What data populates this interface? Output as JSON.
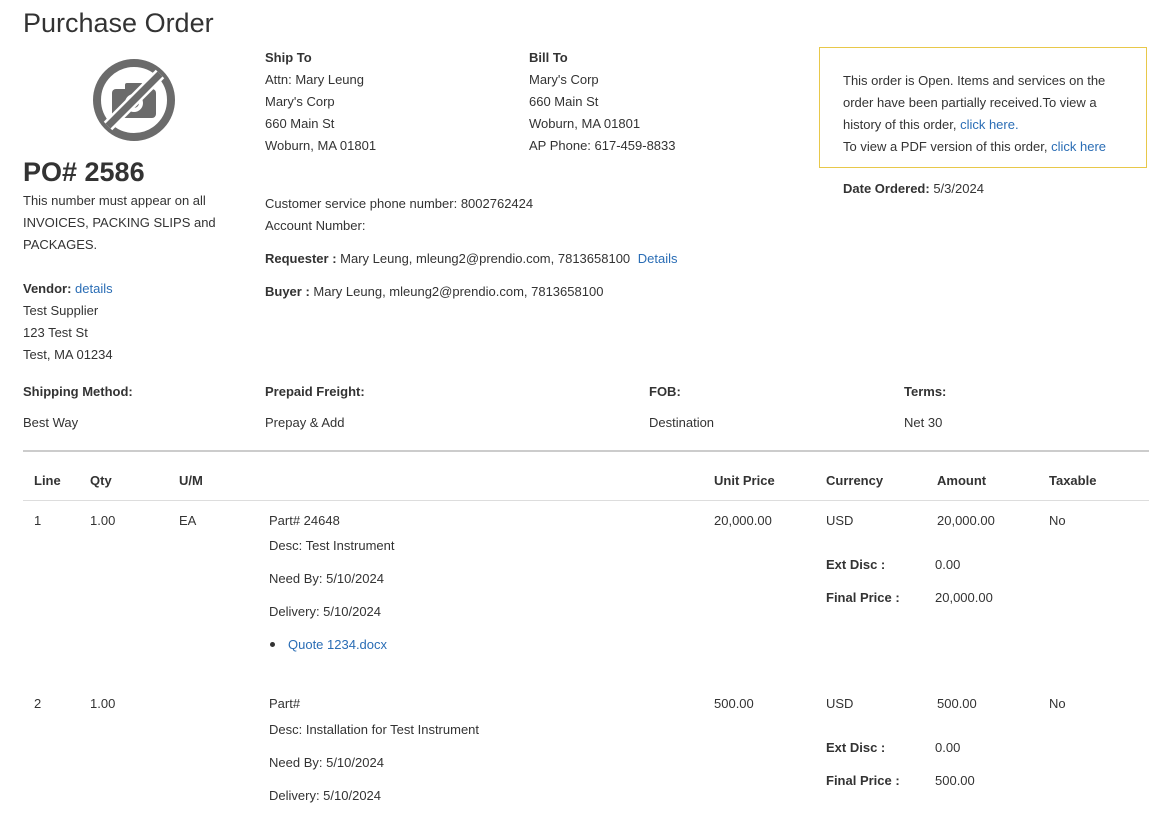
{
  "page": {
    "title": "Purchase Order"
  },
  "logo": {
    "icon": "no-camera-icon"
  },
  "po": {
    "number": "PO# 2586",
    "notice": [
      "This number must appear on all",
      "INVOICES, PACKING SLIPS and",
      "PACKAGES."
    ]
  },
  "vendor": {
    "label": "Vendor:",
    "details_link": "details",
    "name": "Test Supplier",
    "address1": "123 Test St",
    "address2": "Test, MA 01234"
  },
  "ship_to": {
    "label": "Ship To",
    "attn": "Attn: Mary Leung",
    "company": "Mary's Corp",
    "street": "660 Main St",
    "city": "Woburn, MA 01801"
  },
  "bill_to": {
    "label": "Bill To",
    "company": "Mary's Corp",
    "street": "660 Main St",
    "city": "Woburn, MA 01801",
    "phone": "AP Phone: 617-459-8833"
  },
  "status": {
    "text": "This order is Open. Items and services on the order have been partially received.To view a history of this order, ",
    "history_link": "click here.",
    "pdf_text": "To view a PDF version of this order, ",
    "pdf_link": "click here"
  },
  "date_ordered": {
    "label": "Date Ordered:",
    "value": "5/3/2024"
  },
  "contact": {
    "customer_service": "Customer service phone number: 8002762424",
    "account_number": "Account Number:",
    "requester_label": "Requester :",
    "requester_value": "Mary Leung, mleung2@prendio.com, 7813658100",
    "requester_details": "Details",
    "buyer_label": "Buyer :",
    "buyer_value": "Mary Leung, mleung2@prendio.com, 7813658100"
  },
  "shipping": {
    "method_label": "Shipping Method:",
    "method_value": "Best Way",
    "freight_label": "Prepaid Freight:",
    "freight_value": "Prepay & Add",
    "fob_label": "FOB:",
    "fob_value": "Destination",
    "terms_label": "Terms:",
    "terms_value": "Net 30"
  },
  "table": {
    "headers": {
      "line": "Line",
      "qty": "Qty",
      "um": "U/M",
      "unit_price": "Unit Price",
      "currency": "Currency",
      "amount": "Amount",
      "taxable": "Taxable"
    },
    "ext_disc_label": "Ext Disc :",
    "final_price_label": "Final Price :",
    "rows": [
      {
        "line": "1",
        "qty": "1.00",
        "um": "EA",
        "part": "Part# 24648",
        "desc": "Desc: Test Instrument",
        "need_by": "Need By: 5/10/2024",
        "delivery": "Delivery: 5/10/2024",
        "attachment": "Quote 1234.docx",
        "unit_price": "20,000.00",
        "currency": "USD",
        "amount": "20,000.00",
        "taxable": "No",
        "ext_disc": "0.00",
        "final_price": "20,000.00"
      },
      {
        "line": "2",
        "qty": "1.00",
        "um": "",
        "part": "Part#",
        "desc": "Desc: Installation for Test Instrument",
        "need_by": "Need By: 5/10/2024",
        "delivery": "Delivery: 5/10/2024",
        "unit_price": "500.00",
        "currency": "USD",
        "amount": "500.00",
        "taxable": "No",
        "ext_disc": "0.00",
        "final_price": "500.00"
      }
    ]
  }
}
